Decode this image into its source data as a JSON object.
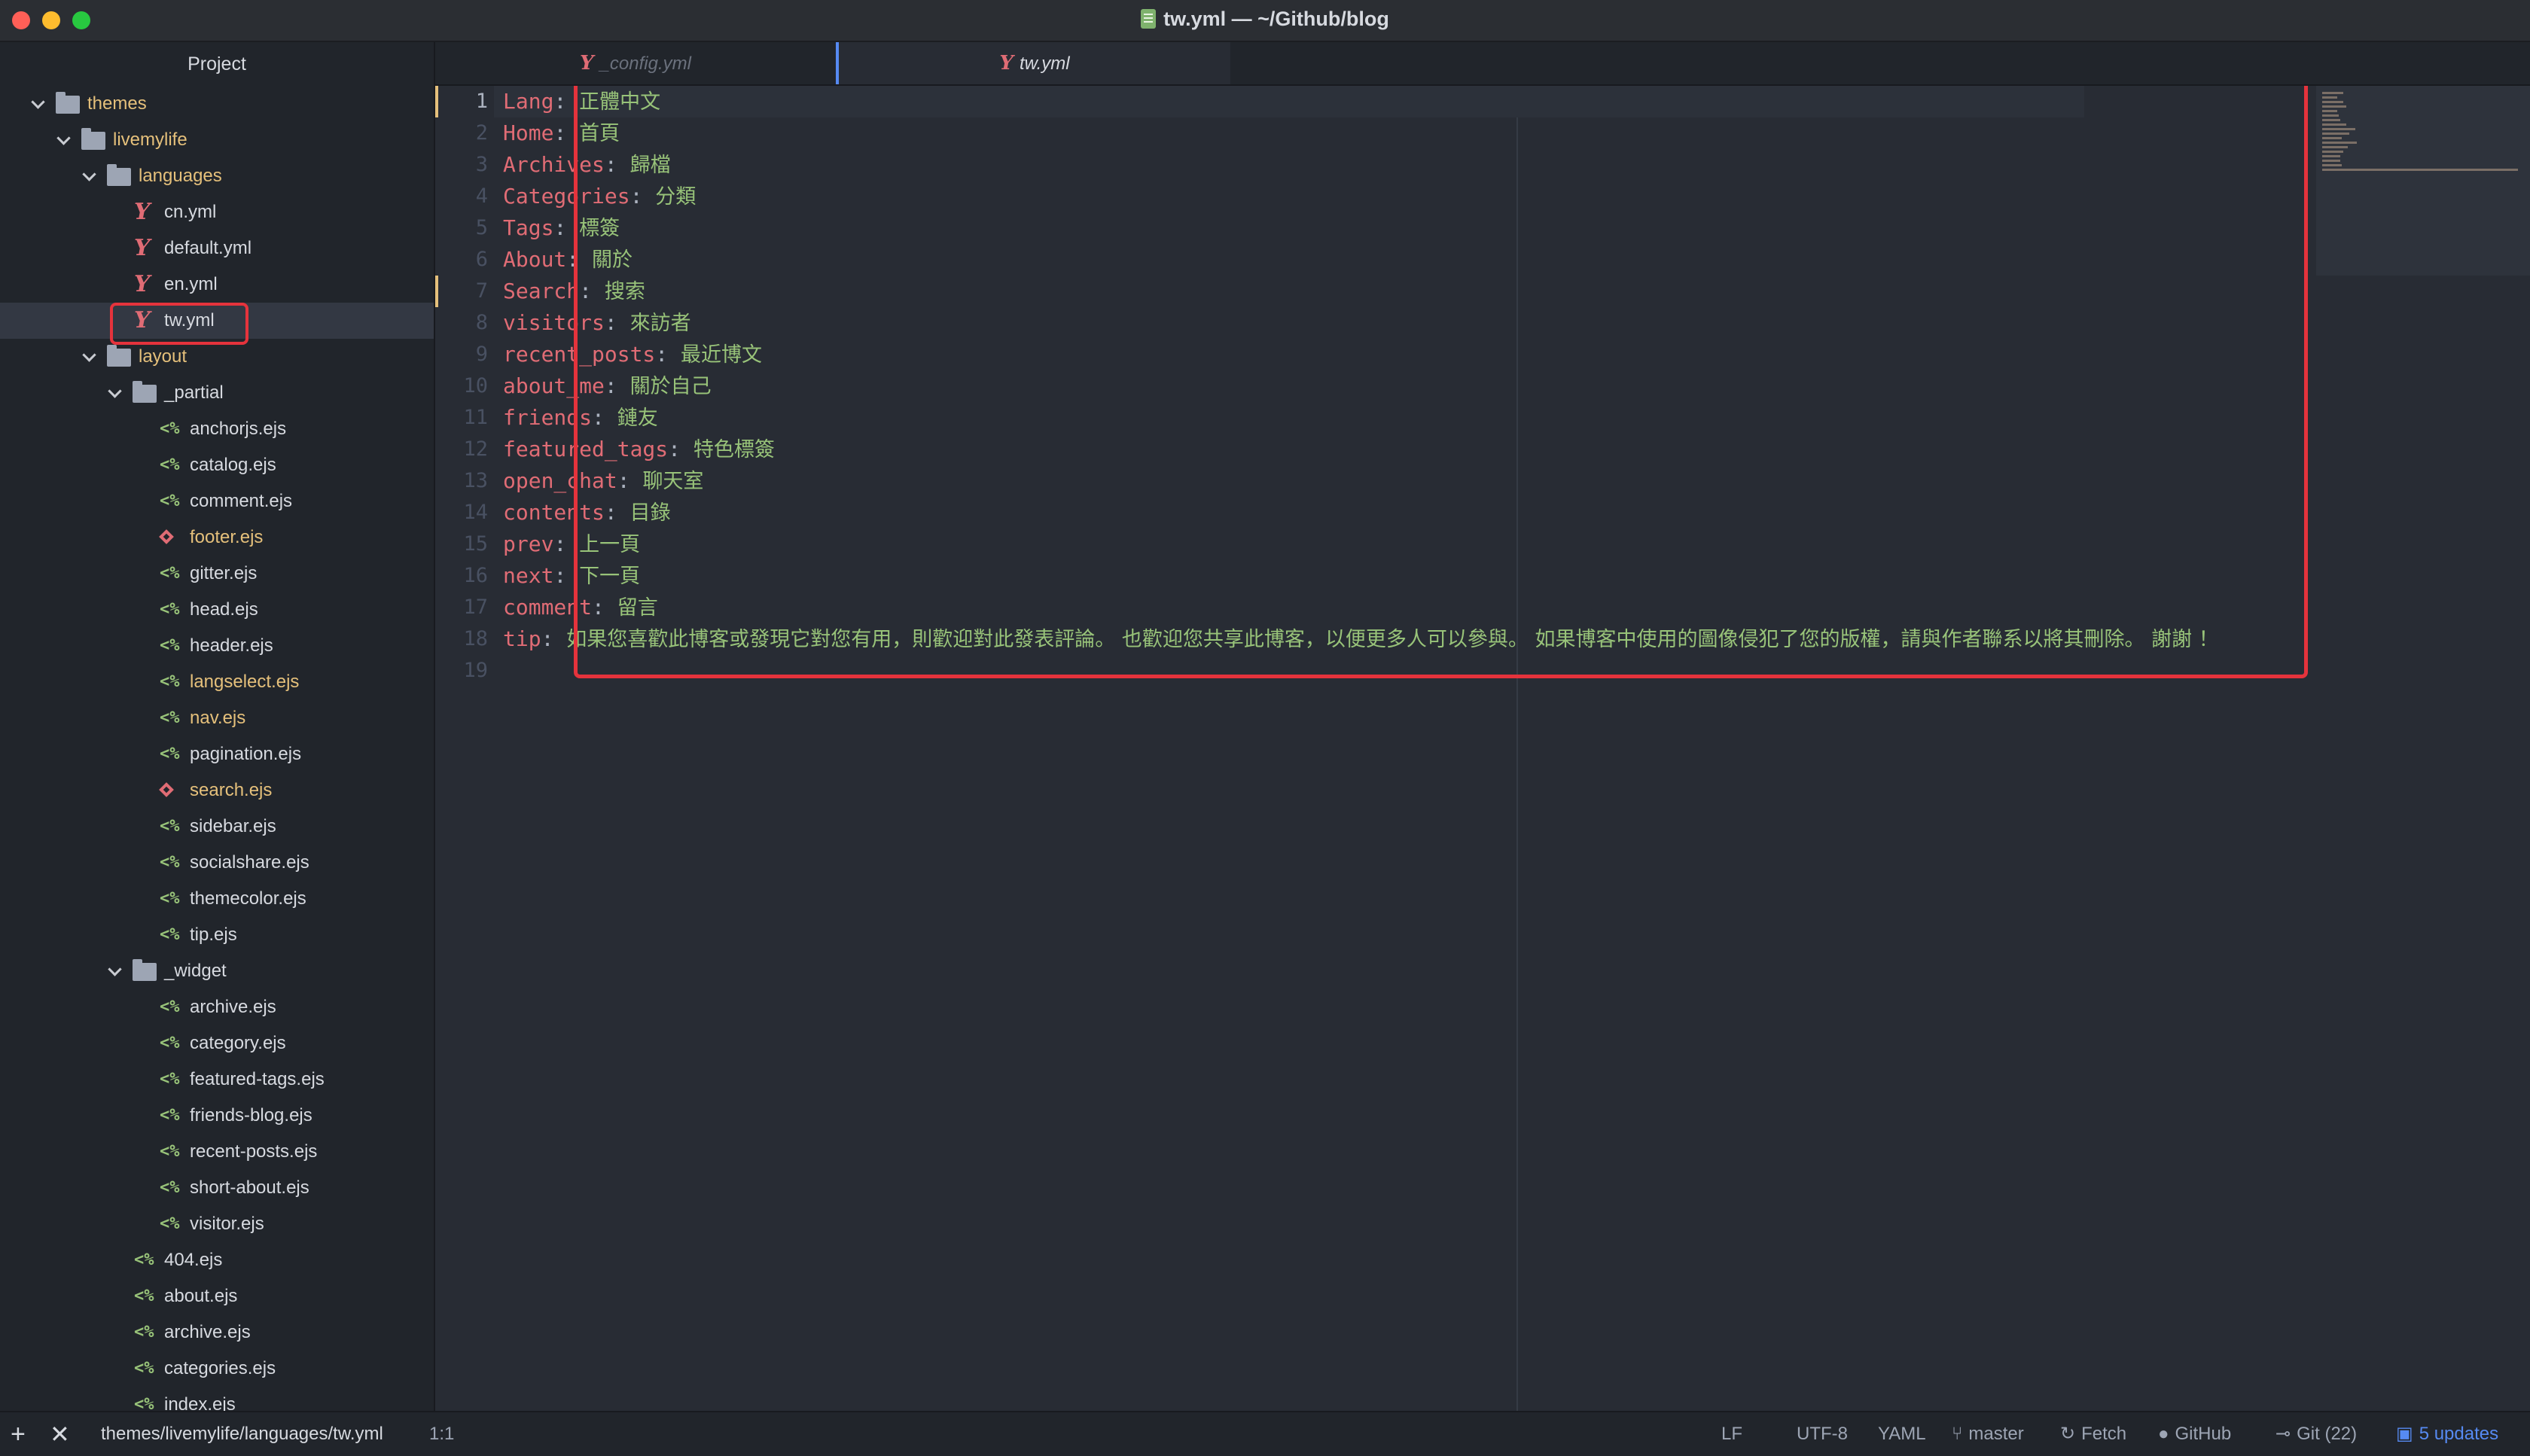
{
  "window": {
    "title": "tw.yml — ~/Github/blog",
    "file_icon": "text-file-icon"
  },
  "sidebar": {
    "header": "Project",
    "tree": [
      {
        "label": "themes",
        "kind": "folder",
        "depth": 0,
        "expanded": true
      },
      {
        "label": "livemylife",
        "kind": "folder",
        "depth": 1,
        "expanded": true
      },
      {
        "label": "languages",
        "kind": "folder",
        "depth": 2,
        "expanded": true
      },
      {
        "label": "cn.yml",
        "kind": "yaml",
        "depth": 3
      },
      {
        "label": "default.yml",
        "kind": "yaml",
        "depth": 3
      },
      {
        "label": "en.yml",
        "kind": "yaml",
        "depth": 3
      },
      {
        "label": "tw.yml",
        "kind": "yaml",
        "depth": 3,
        "selected": true
      },
      {
        "label": "layout",
        "kind": "folder",
        "depth": 2,
        "expanded": true
      },
      {
        "label": "_partial",
        "kind": "folder",
        "depth": 3,
        "expanded": true
      },
      {
        "label": "anchorjs.ejs",
        "kind": "ejs",
        "depth": 4
      },
      {
        "label": "catalog.ejs",
        "kind": "ejs",
        "depth": 4
      },
      {
        "label": "comment.ejs",
        "kind": "ejs",
        "depth": 4
      },
      {
        "label": "footer.ejs",
        "kind": "ruby",
        "depth": 4,
        "status": "modified"
      },
      {
        "label": "gitter.ejs",
        "kind": "ejs",
        "depth": 4
      },
      {
        "label": "head.ejs",
        "kind": "ejs",
        "depth": 4
      },
      {
        "label": "header.ejs",
        "kind": "ejs",
        "depth": 4
      },
      {
        "label": "langselect.ejs",
        "kind": "ejs",
        "depth": 4,
        "status": "modified"
      },
      {
        "label": "nav.ejs",
        "kind": "ejs",
        "depth": 4,
        "status": "modified"
      },
      {
        "label": "pagination.ejs",
        "kind": "ejs",
        "depth": 4
      },
      {
        "label": "search.ejs",
        "kind": "ruby",
        "depth": 4,
        "status": "modified"
      },
      {
        "label": "sidebar.ejs",
        "kind": "ejs",
        "depth": 4
      },
      {
        "label": "socialshare.ejs",
        "kind": "ejs",
        "depth": 4
      },
      {
        "label": "themecolor.ejs",
        "kind": "ejs",
        "depth": 4
      },
      {
        "label": "tip.ejs",
        "kind": "ejs",
        "depth": 4
      },
      {
        "label": "_widget",
        "kind": "folder",
        "depth": 3,
        "expanded": true
      },
      {
        "label": "archive.ejs",
        "kind": "ejs",
        "depth": 4
      },
      {
        "label": "category.ejs",
        "kind": "ejs",
        "depth": 4
      },
      {
        "label": "featured-tags.ejs",
        "kind": "ejs",
        "depth": 4
      },
      {
        "label": "friends-blog.ejs",
        "kind": "ejs",
        "depth": 4
      },
      {
        "label": "recent-posts.ejs",
        "kind": "ejs",
        "depth": 4
      },
      {
        "label": "short-about.ejs",
        "kind": "ejs",
        "depth": 4
      },
      {
        "label": "visitor.ejs",
        "kind": "ejs",
        "depth": 4
      },
      {
        "label": "404.ejs",
        "kind": "ejs",
        "depth": 3
      },
      {
        "label": "about.ejs",
        "kind": "ejs",
        "depth": 3
      },
      {
        "label": "archive.ejs",
        "kind": "ejs",
        "depth": 3
      },
      {
        "label": "categories.ejs",
        "kind": "ejs",
        "depth": 3
      },
      {
        "label": "index.ejs",
        "kind": "ejs",
        "depth": 3
      }
    ]
  },
  "tabs": [
    {
      "label": "_config.yml",
      "active": false
    },
    {
      "label": "tw.yml",
      "active": true
    }
  ],
  "editor": {
    "lines": [
      {
        "n": "1",
        "key": "Lang",
        "value": "正體中文"
      },
      {
        "n": "2",
        "key": "Home",
        "value": "首頁"
      },
      {
        "n": "3",
        "key": "Archives",
        "value": "歸檔"
      },
      {
        "n": "4",
        "key": "Categories",
        "value": "分類"
      },
      {
        "n": "5",
        "key": "Tags",
        "value": "標簽"
      },
      {
        "n": "6",
        "key": "About",
        "value": "關於"
      },
      {
        "n": "7",
        "key": "Search",
        "value": "搜索"
      },
      {
        "n": "8",
        "key": "visitors",
        "value": "來訪者"
      },
      {
        "n": "9",
        "key": "recent_posts",
        "value": "最近博文"
      },
      {
        "n": "10",
        "key": "about_me",
        "value": "關於自己"
      },
      {
        "n": "11",
        "key": "friends",
        "value": "鏈友"
      },
      {
        "n": "12",
        "key": "featured_tags",
        "value": "特色標簽"
      },
      {
        "n": "13",
        "key": "open_chat",
        "value": "聊天室"
      },
      {
        "n": "14",
        "key": "contents",
        "value": "目錄"
      },
      {
        "n": "15",
        "key": "prev",
        "value": "上一頁"
      },
      {
        "n": "16",
        "key": "next",
        "value": "下一頁"
      },
      {
        "n": "17",
        "key": "comment",
        "value": "留言"
      },
      {
        "n": "18",
        "key": "tip",
        "value": "如果您喜歡此博客或發現它對您有用，則歡迎對此發表評論。 也歡迎您共享此博客，以便更多人可以參與。 如果博客中使用的圖像侵犯了您的版權，請與作者聯系以將其刪除。 謝謝 ！"
      },
      {
        "n": "19",
        "key": "",
        "value": ""
      }
    ]
  },
  "statusbar": {
    "add_icon": "+",
    "close_icon": "✕",
    "path": "themes/livemylife/languages/tw.yml",
    "cursor": "1:1",
    "line_ending": "LF",
    "encoding": "UTF-8",
    "grammar": "YAML",
    "branch": "master",
    "fetch": "Fetch",
    "github": "GitHub",
    "git": "Git (22)",
    "updates": "5 updates"
  },
  "colors": {
    "accent": "#568af2",
    "annotation_red": "#e5333c",
    "modified": "#e5c07b",
    "added": "#98c379"
  }
}
